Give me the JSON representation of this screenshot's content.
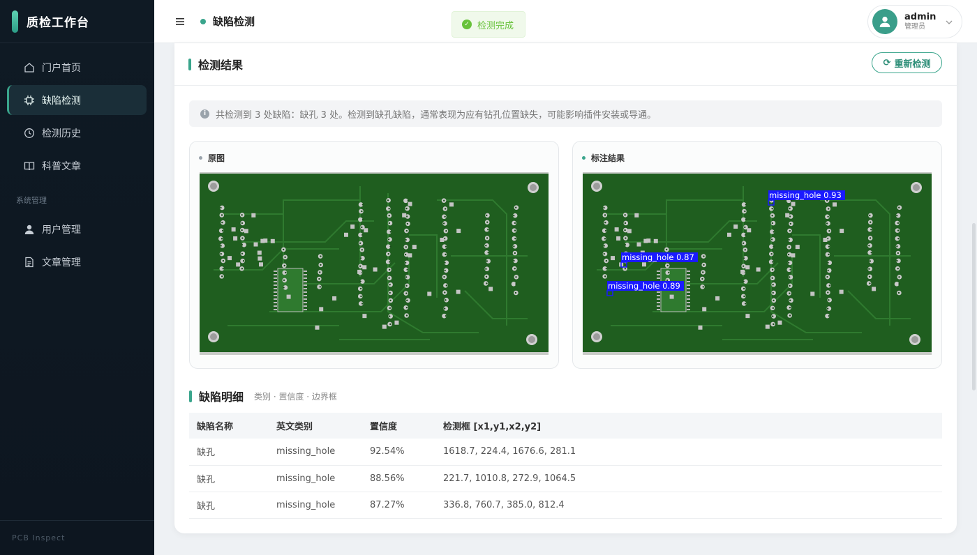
{
  "brand": {
    "title": "质检工作台",
    "footer": "PCB Inspect"
  },
  "sidebar": {
    "items": [
      {
        "label": "门户首页",
        "icon": "home-icon",
        "active": false
      },
      {
        "label": "缺陷检测",
        "icon": "chip-icon",
        "active": true
      },
      {
        "label": "检测历史",
        "icon": "clock-icon",
        "active": false
      },
      {
        "label": "科普文章",
        "icon": "book-icon",
        "active": false
      }
    ],
    "section_label": "系统管理",
    "admin_items": [
      {
        "label": "用户管理",
        "icon": "user-icon"
      },
      {
        "label": "文章管理",
        "icon": "document-icon"
      }
    ]
  },
  "header": {
    "breadcrumb": "缺陷检测",
    "toast": "检测完成",
    "user": {
      "name": "admin",
      "role": "管理员"
    }
  },
  "result": {
    "title": "检测结果",
    "redo_label": "重新检测",
    "summary": "共检测到 3 处缺陷：缺孔 3 处。检测到缺孔缺陷，通常表现为应有钻孔位置缺失，可能影响插件安装或导通。",
    "original_label": "原图",
    "annotated_label": "标注结果",
    "annotations": [
      "missing_hole 0.93",
      "missing_hole 0.87",
      "missing_hole 0.89"
    ]
  },
  "detail": {
    "title": "缺陷明细",
    "subtitle": "类别 · 置信度 · 边界框",
    "headers": [
      "缺陷名称",
      "英文类别",
      "置信度",
      "检测框 [x1,y1,x2,y2]"
    ],
    "rows": [
      [
        "缺孔",
        "missing_hole",
        "92.54%",
        "1618.7, 224.4, 1676.6, 281.1"
      ],
      [
        "缺孔",
        "missing_hole",
        "88.56%",
        "221.7, 1010.8, 272.9, 1064.5"
      ],
      [
        "缺孔",
        "missing_hole",
        "87.27%",
        "336.8, 760.7, 385.0, 812.4"
      ]
    ]
  },
  "colors": {
    "accent": "#3aa58c",
    "sidebar_bg": "#0f1a24",
    "pcb_green": "#1f5e1f",
    "success": "#67c23a",
    "bbox": "#1a1aff"
  }
}
